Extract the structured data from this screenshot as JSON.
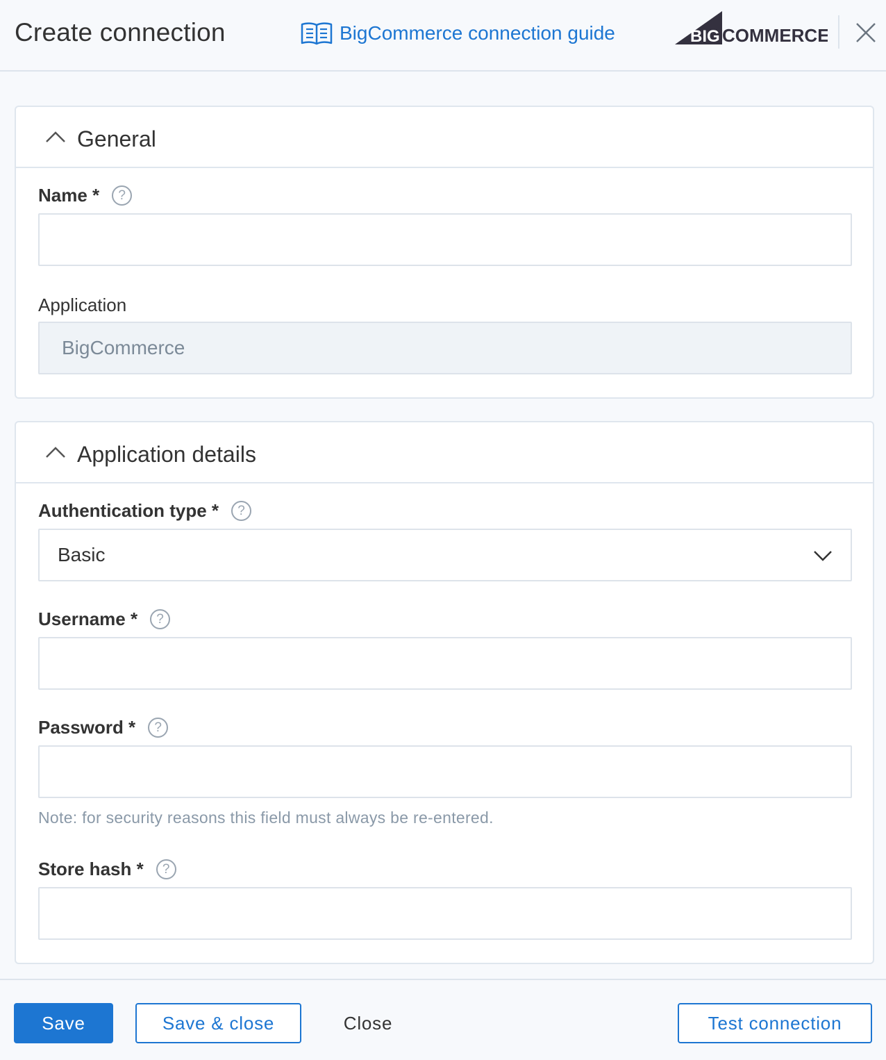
{
  "header": {
    "title": "Create connection",
    "guide_link": "BigCommerce connection guide",
    "logo_text": "BIGCOMMERCE",
    "icons": {
      "guide": "book-icon",
      "close": "close-icon"
    }
  },
  "general": {
    "title": "General",
    "name": {
      "label": "Name *",
      "value": "",
      "placeholder": ""
    },
    "application": {
      "label": "Application",
      "value": "BigCommerce"
    }
  },
  "app_details": {
    "title": "Application details",
    "auth_type": {
      "label": "Authentication type *",
      "value": "Basic"
    },
    "username": {
      "label": "Username *",
      "value": ""
    },
    "password": {
      "label": "Password *",
      "value": "",
      "note": "Note: for security reasons this field must always be re-entered."
    },
    "store_hash": {
      "label": "Store hash *",
      "value": ""
    }
  },
  "footer": {
    "save": "Save",
    "save_close": "Save & close",
    "close": "Close",
    "test": "Test connection"
  },
  "colors": {
    "accent": "#1d76d2",
    "border": "#dde3ea",
    "background": "#f7f9fc"
  }
}
